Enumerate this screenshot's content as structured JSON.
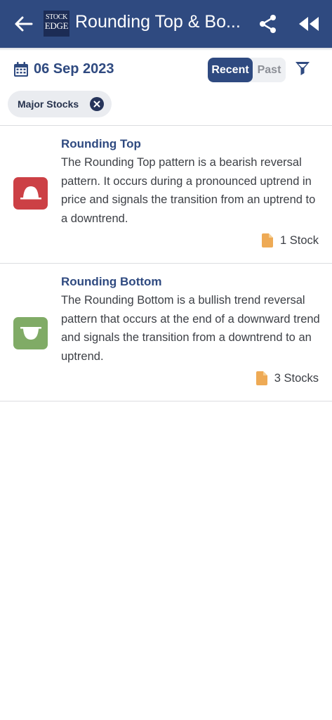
{
  "header": {
    "title": "Rounding Top & Bo...",
    "logo_line1": "STOCK",
    "logo_line2": "EDGE",
    "icons": [
      "back-arrow-icon",
      "share-icon",
      "rewind-icon"
    ],
    "color": "#2f4a80"
  },
  "filters": {
    "date": "06 Sep 2023",
    "segments": {
      "recent": "Recent",
      "past": "Past",
      "selected": "Recent"
    },
    "chip": "Major Stocks"
  },
  "patterns": [
    {
      "title": "Rounding Top",
      "description": "The Rounding Top pattern is a bearish reversal pattern. It occurs during a pronounced uptrend in price and signals the transition from an uptrend to a downtrend.",
      "count": "1 Stock",
      "icon": "rounding-top-icon",
      "icon_color": "#cc4045"
    },
    {
      "title": "Rounding Bottom",
      "description": "The Rounding Bottom is a bullish trend reversal pattern that occurs at the end of a downward trend and signals the transition from a downtrend to an uptrend.",
      "count": "3 Stocks",
      "icon": "rounding-bottom-icon",
      "icon_color": "#80ab66"
    }
  ]
}
